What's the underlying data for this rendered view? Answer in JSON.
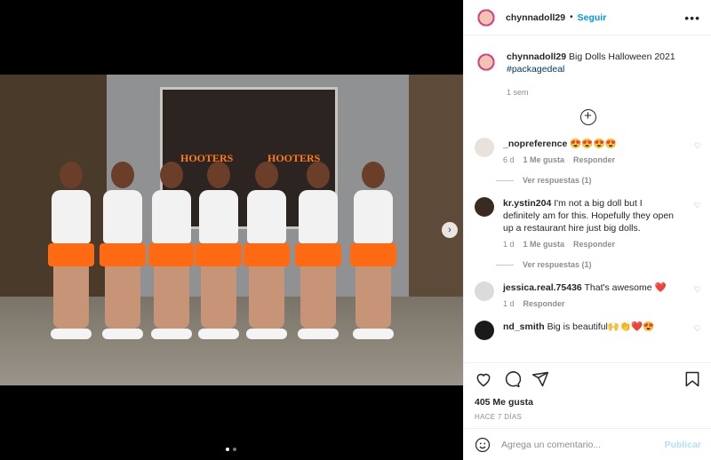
{
  "post": {
    "username": "chynnadoll29",
    "follow_label": "Seguir",
    "separator": "•",
    "more_label": "•••",
    "caption_text": "Big Dolls Halloween 2021",
    "caption_tag": "#packagedeal",
    "caption_age": "1 sem",
    "load_more": "+"
  },
  "media": {
    "sign_text": "HOOTERS",
    "next_label": "›",
    "photo_count": 2,
    "active_photo": 1
  },
  "comments": [
    {
      "user": "_nopreference",
      "text": "😍😍😍😍",
      "age": "6 d",
      "likes": "1 Me gusta",
      "reply": "Responder",
      "replies": "Ver respuestas (1)",
      "color": "#e9e2dc"
    },
    {
      "user": "kr.ystin204",
      "text": "I'm not a big doll but I definitely am for this. Hopefully they open up a restaurant hire just big dolls.",
      "age": "1 d",
      "likes": "1 Me gusta",
      "reply": "Responder",
      "replies": "Ver respuestas (1)",
      "color": "#3a2a22"
    },
    {
      "user": "jessica.real.75436",
      "text": "That's awesome ❤️",
      "age": "1 d",
      "reply": "Responder",
      "color": "#dbdbdb"
    },
    {
      "user": "nd_smith",
      "text": "Big is beautiful🙌👏❤️😍",
      "color": "#1a1a1a"
    }
  ],
  "actions": {
    "likes": "405 Me gusta",
    "date": "HACE 7 DÍAS",
    "comment_placeholder": "Agrega un comentario...",
    "publish_label": "Publicar",
    "heart_glyph": "♡"
  },
  "colors": {
    "accent": "#0095f6",
    "publish_disabled": "#b2dffc",
    "shorts": "#ff6a13"
  }
}
